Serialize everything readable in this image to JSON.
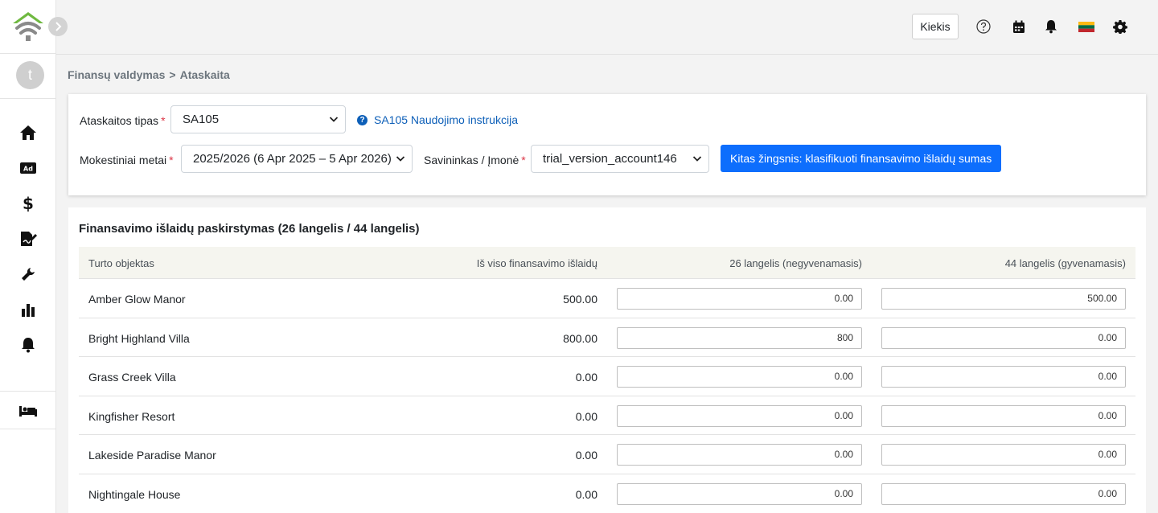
{
  "header": {
    "kiekis_label": "Kiekis"
  },
  "sidebar": {
    "avatar_initial": "t"
  },
  "breadcrumb": {
    "parent": "Finansų valdymas",
    "separator": ">",
    "current": "Ataskaita"
  },
  "filters": {
    "report_type_label": "Ataskaitos tipas",
    "report_type_value": "SA105",
    "help_link": "SA105 Naudojimo instrukcija",
    "tax_year_label": "Mokestiniai metai",
    "tax_year_value": "2025/2026 (6 Apr 2025 – 5 Apr 2026)",
    "owner_label": "Savininkas / Įmonė",
    "owner_value": "trial_version_account146",
    "required_mark": "*",
    "next_button": "Kitas žingsnis: klasifikuoti finansavimo išlaidų sumas"
  },
  "table": {
    "title": "Finansavimo išlaidų paskirstymas (26 langelis / 44 langelis)",
    "columns": [
      "Turto objektas",
      "Iš viso finansavimo išlaidų",
      "26 langelis (negyvenamasis)",
      "44 langelis (gyvenamasis)"
    ],
    "rows": [
      {
        "name": "Amber Glow Manor",
        "total": "500.00",
        "box26": "0.00",
        "box44": "500.00"
      },
      {
        "name": "Bright Highland Villa",
        "total": "800.00",
        "box26": "800",
        "box44": "0.00"
      },
      {
        "name": "Grass Creek Villa",
        "total": "0.00",
        "box26": "0.00",
        "box44": "0.00"
      },
      {
        "name": "Kingfisher Resort",
        "total": "0.00",
        "box26": "0.00",
        "box44": "0.00"
      },
      {
        "name": "Lakeside Paradise Manor",
        "total": "0.00",
        "box26": "0.00",
        "box44": "0.00"
      },
      {
        "name": "Nightingale House",
        "total": "0.00",
        "box26": "0.00",
        "box44": "0.00"
      }
    ]
  },
  "colors": {
    "primary": "#0d6efd",
    "link": "#0d5fb8",
    "logo_green": "#6fb940",
    "logo_gray": "#8a8a8a"
  }
}
